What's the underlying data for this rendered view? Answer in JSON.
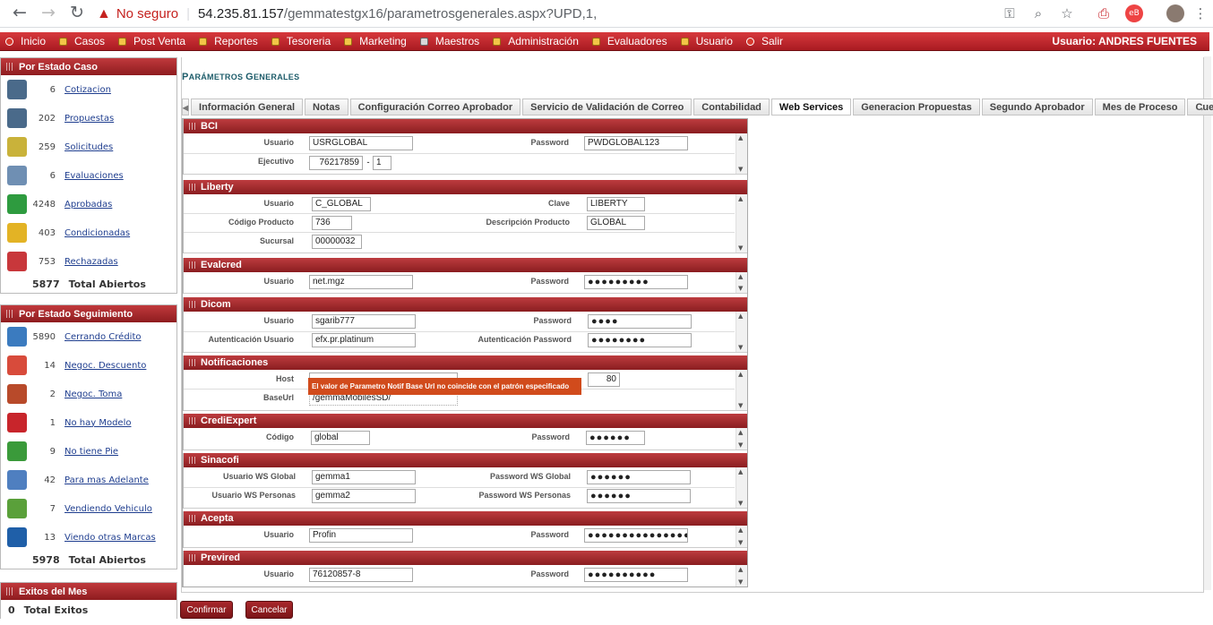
{
  "browser": {
    "warning": "No seguro",
    "url_host": "54.235.81.157",
    "url_path": "/gemmatestgx16/parametrosgenerales.aspx?UPD,1,"
  },
  "menu": {
    "items": [
      {
        "label": "Inicio",
        "icon": "home-icon"
      },
      {
        "label": "Casos",
        "icon": "folder-icon"
      },
      {
        "label": "Post Venta",
        "icon": "folder-icon"
      },
      {
        "label": "Reportes",
        "icon": "folder-icon"
      },
      {
        "label": "Tesoreria",
        "icon": "coin-icon"
      },
      {
        "label": "Marketing",
        "icon": "card-icon"
      },
      {
        "label": "Maestros",
        "icon": "db-icon"
      },
      {
        "label": "Administración",
        "icon": "key-icon"
      },
      {
        "label": "Evaluadores",
        "icon": "check-icon"
      },
      {
        "label": "Usuario",
        "icon": "check-icon"
      },
      {
        "label": "Salir",
        "icon": "exit-icon"
      }
    ],
    "user": "Usuario: ANDRES FUENTES"
  },
  "sidebar": {
    "estado_caso": {
      "title": "Por Estado Caso",
      "items": [
        {
          "num": "6",
          "label": "Cotizacion",
          "color": "#4a6a8a"
        },
        {
          "num": "202",
          "label": "Propuestas",
          "color": "#4a6a8a"
        },
        {
          "num": "259",
          "label": "Solicitudes",
          "color": "#c9b23a"
        },
        {
          "num": "6",
          "label": "Evaluaciones",
          "color": "#6f8fb3"
        },
        {
          "num": "4248",
          "label": "Aprobadas",
          "color": "#2e9b3f"
        },
        {
          "num": "403",
          "label": "Condicionadas",
          "color": "#e3b325"
        },
        {
          "num": "753",
          "label": "Rechazadas",
          "color": "#c8373b"
        }
      ],
      "total_num": "5877",
      "total_label": "Total Abiertos"
    },
    "estado_seguimiento": {
      "title": "Por Estado Seguimiento",
      "items": [
        {
          "num": "5890",
          "label": "Cerrando Crédito",
          "color": "#3b7bbf"
        },
        {
          "num": "14",
          "label": "Negoc. Descuento",
          "color": "#d84b3b"
        },
        {
          "num": "2",
          "label": "Negoc. Toma",
          "color": "#b84a2a"
        },
        {
          "num": "1",
          "label": "No hay Modelo",
          "color": "#c8252b"
        },
        {
          "num": "9",
          "label": "No tiene Pie",
          "color": "#3a9a3a"
        },
        {
          "num": "42",
          "label": "Para mas Adelante",
          "color": "#4f7fc0"
        },
        {
          "num": "7",
          "label": "Vendiendo Vehiculo",
          "color": "#5aa03a"
        },
        {
          "num": "13",
          "label": "Viendo otras Marcas",
          "color": "#1f5fa8"
        }
      ],
      "total_num": "5978",
      "total_label": "Total Abiertos"
    },
    "exitos": {
      "title": "Exitos del Mes",
      "total_num": "0",
      "total_label": "Total Exitos"
    }
  },
  "page": {
    "title_first": "P",
    "title_rest": "ARÁMETROS ",
    "title_second": "G",
    "title_rest2": "ENERALES"
  },
  "tabs": [
    "Información General",
    "Notas",
    "Configuración Correo Aprobador",
    "Servicio de Validación de Correo",
    "Contabilidad",
    "Web Services",
    "Generacion Propuestas",
    "Segundo Aprobador",
    "Mes de Proceso",
    "Cuentas"
  ],
  "sections": {
    "bci": {
      "title": "BCI",
      "usuario_lbl": "Usuario",
      "usuario": "USRGLOBAL",
      "password_lbl": "Password",
      "password": "PWDGLOBAL123",
      "ejecutivo_lbl": "Ejecutivo",
      "ejecutivo": "76217859",
      "ejecutivo_sep": "-",
      "ejecutivo_dv": "1"
    },
    "liberty": {
      "title": "Liberty",
      "usuario_lbl": "Usuario",
      "usuario": "C_GLOBAL",
      "clave_lbl": "Clave",
      "clave": "LIBERTY",
      "codigo_lbl": "Código Producto",
      "codigo": "736",
      "descripcion_lbl": "Descripción Producto",
      "descripcion": "GLOBAL",
      "sucursal_lbl": "Sucursal",
      "sucursal": "00000032"
    },
    "evalcred": {
      "title": "Evalcred",
      "usuario_lbl": "Usuario",
      "usuario": "net.mgz",
      "password_lbl": "Password",
      "password": "●●●●●●●●●"
    },
    "dicom": {
      "title": "Dicom",
      "usuario_lbl": "Usuario",
      "usuario": "sgarib777",
      "password_lbl": "Password",
      "password": "●●●●",
      "auth_user_lbl": "Autenticación Usuario",
      "auth_user": "efx.pr.platinum",
      "auth_pw_lbl": "Autenticación Password",
      "auth_pw": "●●●●●●●●"
    },
    "notificaciones": {
      "title": "Notificaciones",
      "host_lbl": "Host",
      "host": "",
      "port": "80",
      "baseurl_lbl": "BaseUrl",
      "baseurl": "/gemmaMobilesSD/",
      "tooltip": "El valor de Parametro Notif Base Url no coincide con el patrón especificado"
    },
    "crediexpert": {
      "title": "CrediExpert",
      "codigo_lbl": "Código",
      "codigo": "global",
      "password_lbl": "Password",
      "password": "●●●●●●"
    },
    "sinacofi": {
      "title": "Sinacofi",
      "ws_global_lbl": "Usuario WS Global",
      "ws_global": "gemma1",
      "pw_global_lbl": "Password WS Global",
      "pw_global": "●●●●●●",
      "ws_personas_lbl": "Usuario WS Personas",
      "ws_personas": "gemma2",
      "pw_personas_lbl": "Password WS Personas",
      "pw_personas": "●●●●●●"
    },
    "acepta": {
      "title": "Acepta",
      "usuario_lbl": "Usuario",
      "usuario": "Profin",
      "password_lbl": "Password",
      "password": "●●●●●●●●●●●●●●●"
    },
    "previred": {
      "title": "Previred",
      "usuario_lbl": "Usuario",
      "usuario": "76120857-8",
      "password_lbl": "Password",
      "password": "●●●●●●●●●●"
    }
  },
  "buttons": {
    "confirm": "Confirmar",
    "cancel": "Cancelar"
  }
}
